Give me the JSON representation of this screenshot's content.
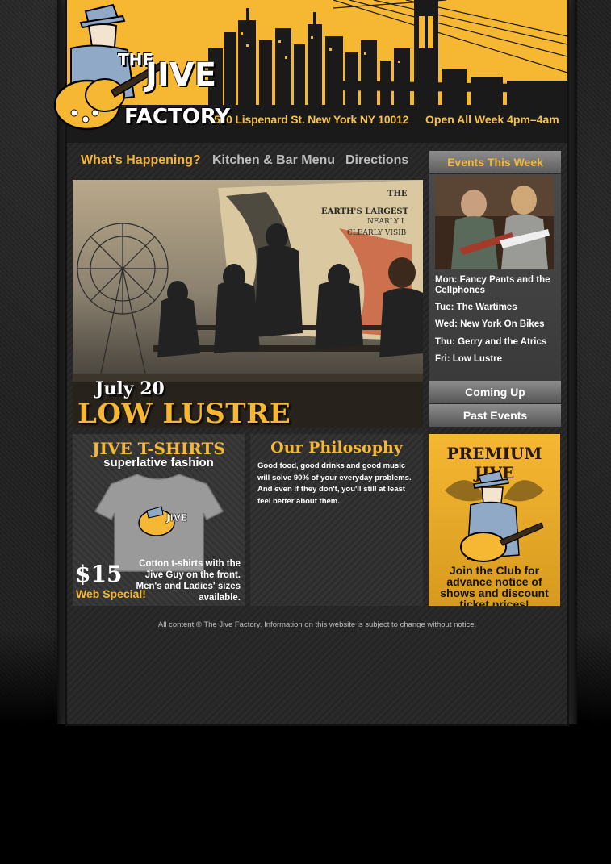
{
  "header": {
    "logo_the": "THE",
    "logo_jive": "JIVE",
    "logo_factory": "FACTORY",
    "address": "580 Lispenard St. New York NY 10012",
    "hours": "Open All Week 4pm–4am"
  },
  "nav": {
    "happening": "What's Happening?",
    "menu": "Kitchen & Bar Menu",
    "directions": "Directions"
  },
  "feature": {
    "mural_line1": "THE",
    "mural_line2": "EARTH'S LARGEST",
    "mural_line3": "NEARLY I",
    "mural_line4": "CLEARLY VISIB",
    "date": "July 20",
    "title": "LOW LUSTRE"
  },
  "sidebar": {
    "heading": "Events This Week",
    "events": [
      "Mon: Fancy Pants and the Cellphones",
      "Tue: The Wartimes",
      "Wed: New York On Bikes",
      "Thu: Gerry and the Atrics",
      "Fri: Low Lustre"
    ],
    "coming_up": "Coming Up",
    "past_events": "Past Events"
  },
  "shirts": {
    "title": "JIVE T-SHIRTS",
    "subtitle": "superlative fashion",
    "price": "$15",
    "special": "Web Special!",
    "description": "Cotton t-shirts with the Jive Guy on the front. Men's and Ladies' sizes available."
  },
  "philosophy": {
    "title": "Our Philosophy",
    "text": "Good food, good drinks and good music will solve 90% of your everyday problems. And even if they don't, you'll still at least feel better about them."
  },
  "premium": {
    "title": "PREMIUM JIVE",
    "text": "Join the Club for advance notice of shows and discount ticket prices!"
  },
  "footer": {
    "text": "All content © The Jive Factory. Information on this website is subject to change without notice."
  },
  "colors": {
    "accent": "#f6b733",
    "background": "#222222"
  }
}
